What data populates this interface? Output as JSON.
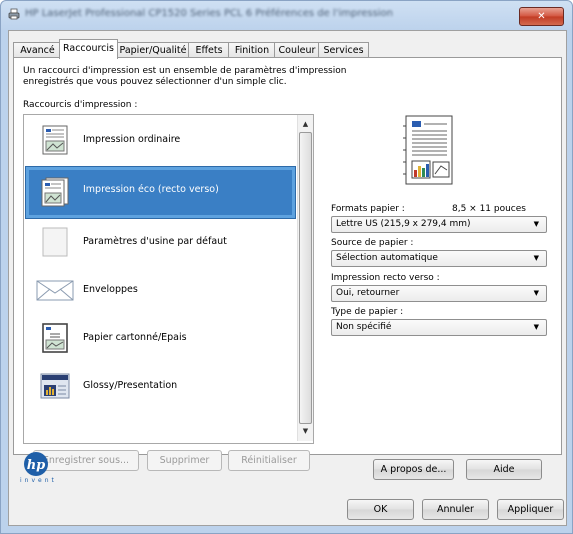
{
  "window": {
    "title": "HP LaserJet Professional CP1520 Series PCL 6 Préférences de l'impression",
    "close_glyph": "✕"
  },
  "tabs": [
    {
      "label": "Avancé"
    },
    {
      "label": "Raccourcis"
    },
    {
      "label": "Papier/Qualité"
    },
    {
      "label": "Effets"
    },
    {
      "label": "Finition"
    },
    {
      "label": "Couleur"
    },
    {
      "label": "Services"
    }
  ],
  "shortcuts": {
    "description": "Un raccourci d'impression est un ensemble de paramètres d'impression enregistrés que vous pouvez sélectionner d'un simple clic.",
    "label": "Raccourcis d'impression :",
    "items": [
      {
        "label": "Impression ordinaire",
        "icon": "document-icon"
      },
      {
        "label": "Impression éco (recto verso)",
        "icon": "duplex-document-icon",
        "selected": true
      },
      {
        "label": "Paramètres d'usine par défaut",
        "icon": "blank-page-icon"
      },
      {
        "label": "Enveloppes",
        "icon": "envelope-icon"
      },
      {
        "label": "Papier cartonné/Epais",
        "icon": "cardstock-icon"
      },
      {
        "label": "Glossy/Presentation",
        "icon": "presentation-icon"
      }
    ],
    "save_label": "Enregistrer sous...",
    "delete_label": "Supprimer",
    "reset_label": "Réinitialiser"
  },
  "settings": {
    "paper_size_label": "Formats papier :",
    "paper_size_dims": "8,5 × 11 pouces",
    "paper_size_value": "Lettre US (215,9 x 279,4 mm)",
    "paper_source_label": "Source de papier :",
    "paper_source_value": "Sélection automatique",
    "duplex_label": "Impression recto verso :",
    "duplex_value": "Oui, retourner",
    "paper_type_label": "Type de papier :",
    "paper_type_value": "Non spécifié"
  },
  "footer": {
    "about_label": "A propos de...",
    "help_label": "Aide",
    "ok_label": "OK",
    "cancel_label": "Annuler",
    "apply_label": "Appliquer",
    "logo_text": "invent"
  },
  "colors": {
    "selection": "#3a7fc5",
    "hp_blue": "#1f5fa8"
  }
}
